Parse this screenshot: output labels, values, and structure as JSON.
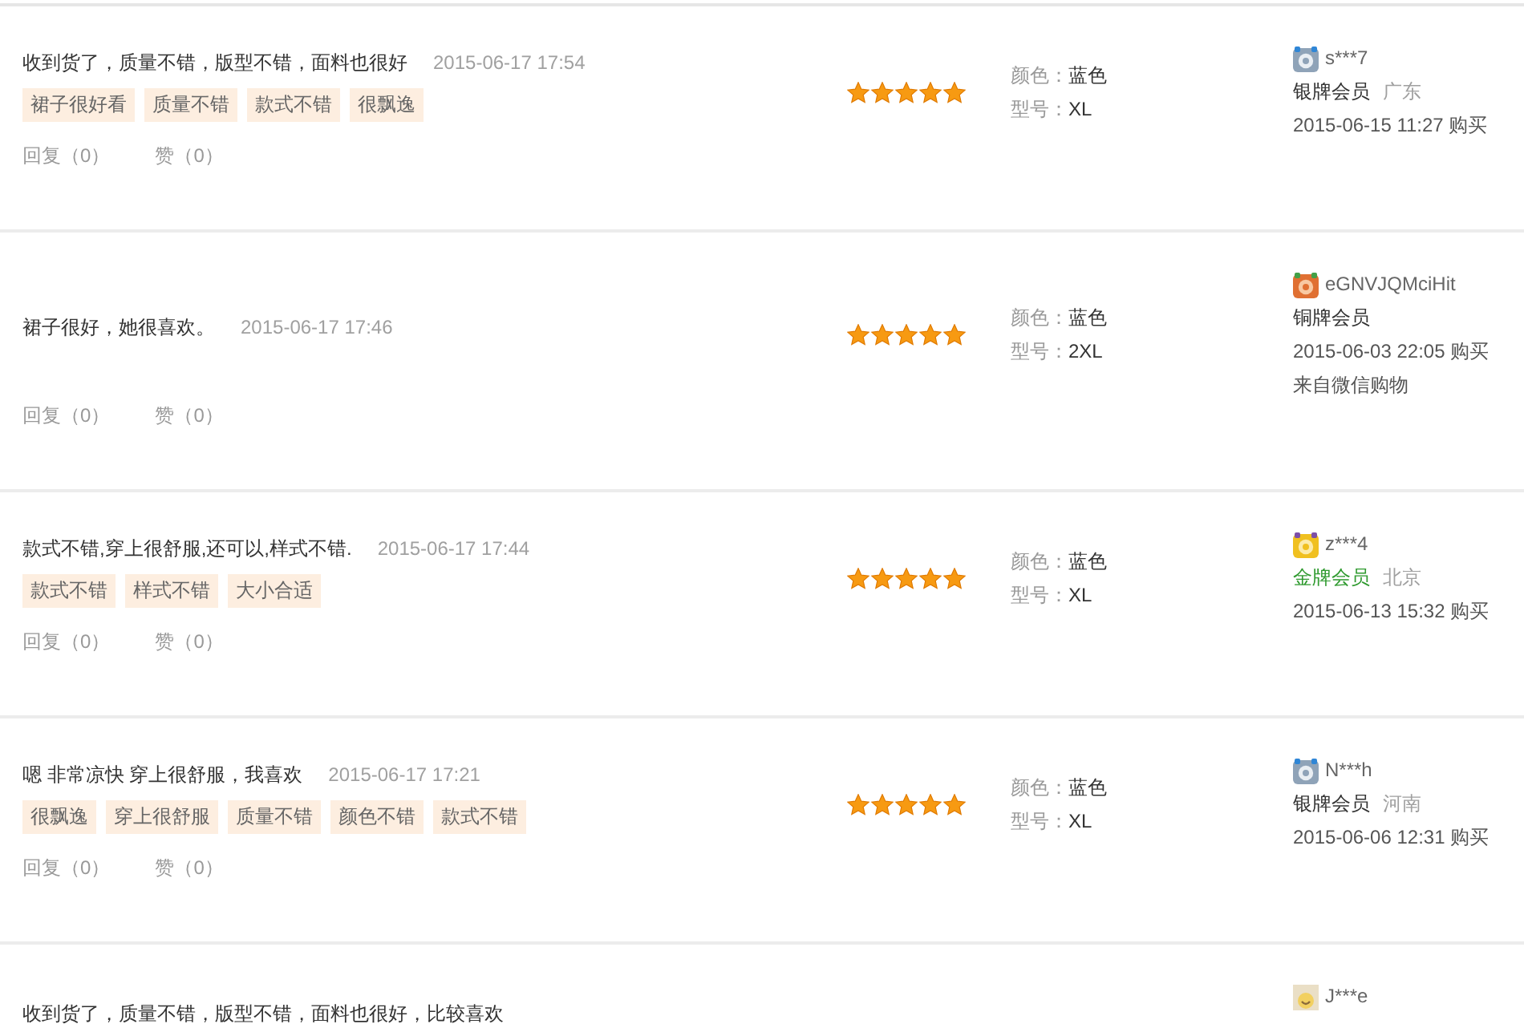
{
  "reviews": [
    {
      "comment": "收到货了，质量不错，版型不错，面料也很好",
      "date": "2015-06-17 17:54",
      "tags": [
        "裙子很好看",
        "质量不错",
        "款式不错",
        "很飘逸"
      ],
      "reply": "回复（0）",
      "like": "赞（0）",
      "stars": 5,
      "specs": [
        {
          "label": "颜色：",
          "value": "蓝色"
        },
        {
          "label": "型号：",
          "value": "XL"
        }
      ],
      "user": {
        "kind": "silver",
        "name": "s***7",
        "level": "银牌会员",
        "location": "广东",
        "purchase": "2015-06-15 11:27 购买"
      }
    },
    {
      "comment": "裙子很好，她很喜欢。",
      "date": "2015-06-17 17:46",
      "reply": "回复（0）",
      "like": "赞（0）",
      "stars": 5,
      "specs": [
        {
          "label": "颜色：",
          "value": "蓝色"
        },
        {
          "label": "型号：",
          "value": "2XL"
        }
      ],
      "user": {
        "kind": "copper",
        "name": "eGNVJQMciHit",
        "level": "铜牌会员",
        "purchase": "2015-06-03 22:05 购买",
        "source": "来自微信购物"
      }
    },
    {
      "comment": "款式不错,穿上很舒服,还可以,样式不错.",
      "date": "2015-06-17 17:44",
      "tags": [
        "款式不错",
        "样式不错",
        "大小合适"
      ],
      "reply": "回复（0）",
      "like": "赞（0）",
      "stars": 5,
      "specs": [
        {
          "label": "颜色：",
          "value": "蓝色"
        },
        {
          "label": "型号：",
          "value": "XL"
        }
      ],
      "user": {
        "kind": "gold",
        "name": "z***4",
        "level": "金牌会员",
        "location": "北京",
        "purchase": "2015-06-13 15:32 购买"
      }
    },
    {
      "comment": "嗯 非常凉快 穿上很舒服，我喜欢",
      "date": "2015-06-17 17:21",
      "tags": [
        "很飘逸",
        "穿上很舒服",
        "质量不错",
        "颜色不错",
        "款式不错"
      ],
      "reply": "回复（0）",
      "like": "赞（0）",
      "stars": 5,
      "specs": [
        {
          "label": "颜色：",
          "value": "蓝色"
        },
        {
          "label": "型号：",
          "value": "XL"
        }
      ],
      "user": {
        "kind": "silver",
        "name": "N***h",
        "level": "银牌会员",
        "location": "河南",
        "purchase": "2015-06-06 12:31 购买"
      }
    },
    {
      "comment": "收到货了，质量不错，版型不错，面料也很好，比较喜欢",
      "user": {
        "kind": "avatar",
        "name": "J***e"
      }
    }
  ]
}
